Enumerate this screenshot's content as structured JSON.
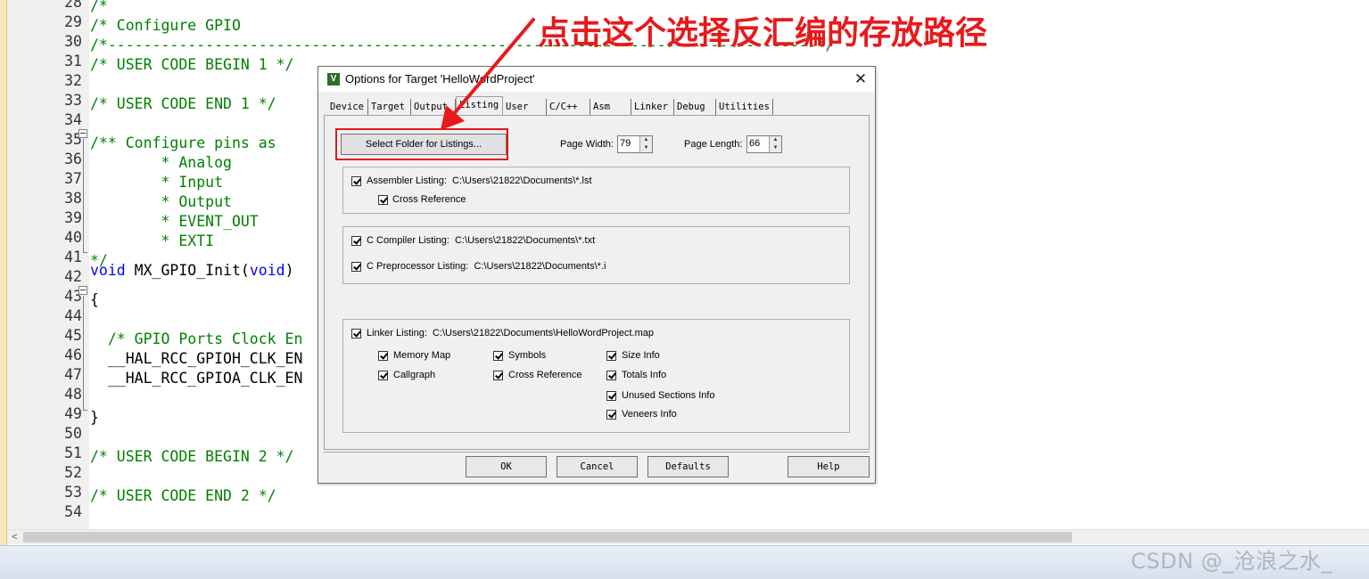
{
  "editor": {
    "lines": [
      {
        "n": "28",
        "text": "/*",
        "cls": "cmt"
      },
      {
        "n": "29",
        "text": "/* Configure GPIO",
        "cls": "cmt"
      },
      {
        "n": "30",
        "text": "/*--------------------------------------------------------------------------------*/",
        "cls": "cmt"
      },
      {
        "n": "31",
        "text": "/* USER CODE BEGIN 1 */",
        "cls": "cmt"
      },
      {
        "n": "32",
        "text": "",
        "cls": "plain"
      },
      {
        "n": "33",
        "text": "/* USER CODE END 1 */",
        "cls": "cmt"
      },
      {
        "n": "34",
        "text": "",
        "cls": "plain"
      },
      {
        "n": "35",
        "text": "/** Configure pins as",
        "cls": "cmt"
      },
      {
        "n": "36",
        "text": "        * Analog",
        "cls": "cmt"
      },
      {
        "n": "37",
        "text": "        * Input",
        "cls": "cmt"
      },
      {
        "n": "38",
        "text": "        * Output",
        "cls": "cmt"
      },
      {
        "n": "39",
        "text": "        * EVENT_OUT",
        "cls": "cmt"
      },
      {
        "n": "40",
        "text": "        * EXTI",
        "cls": "cmt"
      },
      {
        "n": "41",
        "text": "*/",
        "cls": "cmt"
      },
      {
        "n": "42",
        "text": "",
        "cls": "plain"
      },
      {
        "n": "43",
        "text": "{",
        "cls": "plain"
      },
      {
        "n": "44",
        "text": "",
        "cls": "plain"
      },
      {
        "n": "45",
        "text": "  /* GPIO Ports Clock En",
        "cls": "cmt"
      },
      {
        "n": "46",
        "text": "  __HAL_RCC_GPIOH_CLK_EN",
        "cls": "plain"
      },
      {
        "n": "47",
        "text": "  __HAL_RCC_GPIOA_CLK_EN",
        "cls": "plain"
      },
      {
        "n": "48",
        "text": "",
        "cls": "plain"
      },
      {
        "n": "49",
        "text": "}",
        "cls": "plain"
      },
      {
        "n": "50",
        "text": "",
        "cls": "plain"
      },
      {
        "n": "51",
        "text": "/* USER CODE BEGIN 2 */",
        "cls": "cmt"
      },
      {
        "n": "52",
        "text": "",
        "cls": "plain"
      },
      {
        "n": "53",
        "text": "/* USER CODE END 2 */",
        "cls": "cmt"
      },
      {
        "n": "54",
        "text": "",
        "cls": "plain"
      }
    ],
    "line42": {
      "kw1": "void",
      "name": " MX_GPIO_Init(",
      "kw2": "void",
      "close": ")"
    }
  },
  "annotation": {
    "text": "点击这个选择反汇编的存放路径",
    "color": "#e8191b"
  },
  "dialog": {
    "title": "Options for Target 'HelloWordProject'",
    "icon_letter": "V",
    "close_glyph": "✕",
    "tabs": [
      "Device",
      "Target",
      "Output",
      "Listing",
      "User",
      "C/C++",
      "Asm",
      "Linker",
      "Debug",
      "Utilities"
    ],
    "active_tab": "Listing",
    "select_folder_label": "Select Folder for Listings...",
    "page_width_label": "Page Width:",
    "page_width_value": "79",
    "page_length_label": "Page Length:",
    "page_length_value": "66",
    "assembler": {
      "label": "Assembler Listing:",
      "path": "C:\\Users\\21822\\Documents\\*.lst",
      "checked": true,
      "cross_reference": "Cross Reference"
    },
    "c_compiler": {
      "label": "C Compiler Listing:",
      "path": "C:\\Users\\21822\\Documents\\*.txt",
      "checked": true
    },
    "c_preprocessor": {
      "label": "C Preprocessor Listing:",
      "path": "C:\\Users\\21822\\Documents\\*.i",
      "checked": true
    },
    "linker": {
      "label": "Linker Listing:",
      "path": "C:\\Users\\21822\\Documents\\HelloWordProject.map",
      "checked": true,
      "options": {
        "memory_map": "Memory Map",
        "callgraph": "Callgraph",
        "symbols": "Symbols",
        "cross_reference": "Cross Reference",
        "size_info": "Size Info",
        "totals_info": "Totals Info",
        "unused_sections_info": "Unused Sections Info",
        "veneers_info": "Veneers Info"
      }
    },
    "buttons": {
      "ok": "OK",
      "cancel": "Cancel",
      "defaults": "Defaults",
      "help": "Help"
    }
  },
  "scrollbar": {
    "left_arrow": "<"
  },
  "watermark": "CSDN @_沧浪之水_"
}
